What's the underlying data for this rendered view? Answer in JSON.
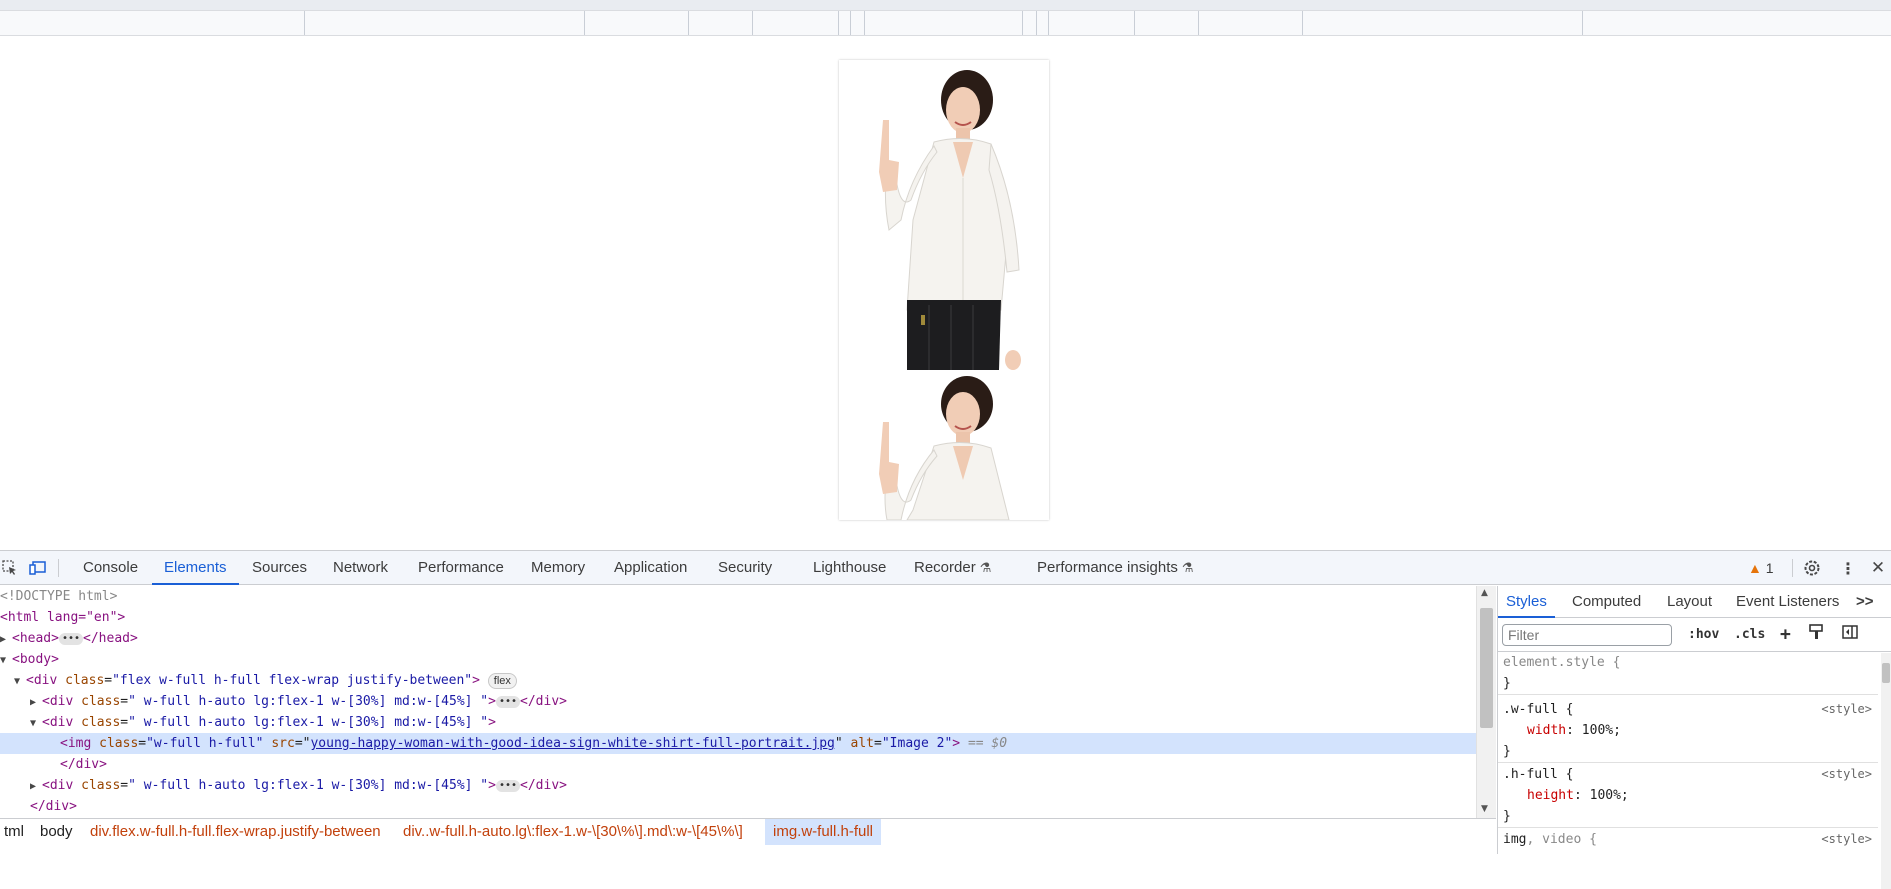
{
  "viewport": {
    "preview": {
      "images": [
        "Image 2",
        "Image 2"
      ]
    }
  },
  "devtools": {
    "tabs": [
      "Console",
      "Elements",
      "Sources",
      "Network",
      "Performance",
      "Memory",
      "Application",
      "Security",
      "Lighthouse",
      "Recorder",
      "Performance insights"
    ],
    "active_tab": "Elements",
    "warnings_count": "1",
    "icons": [
      "inspect-icon",
      "device-toggle-icon",
      "warning-icon",
      "settings-icon",
      "more-icon",
      "close-icon"
    ],
    "elements": {
      "doctype": "<!DOCTYPE html>",
      "html_open": "<html lang=\"en\">",
      "head_open": "<head>",
      "head_close": "</head>",
      "body_open": "<body>",
      "div1_tag": "div",
      "div1_class": "\"flex w-full h-full flex-wrap justify-between\"",
      "div1_badge": "flex",
      "child_class": "\" w-full h-auto lg:flex-1 w-[30%] md:w-[45%] \"",
      "img_class": "\"w-full h-full\"",
      "img_src": "young-happy-woman-with-good-idea-sign-white-shirt-full-portrait.jpg",
      "img_alt": "\"Image 2\"",
      "img_eq": "== $0",
      "div_close": "</div>",
      "attr_class": "class",
      "attr_src": "src",
      "attr_alt": "alt"
    },
    "breadcrumb": [
      "tml",
      "body",
      "div.flex.w-full.h-full.flex-wrap.justify-between",
      "div..w-full.h-auto.lg\\:flex-1.w-\\[30\\%\\].md\\:w-\\[45\\%\\]",
      "img.w-full.h-full"
    ],
    "styles": {
      "tabs": [
        "Styles",
        "Computed",
        "Layout",
        "Event Listeners"
      ],
      "more_tabs": ">>",
      "filter_placeholder": "Filter",
      "hov": ":hov",
      "cls": ".cls",
      "rules": [
        {
          "selector": "element.style {",
          "origin": "",
          "prop": "",
          "val": ""
        },
        {
          "selector": ".w-full {",
          "origin": "<style>",
          "prop": "width",
          "val": "100%;"
        },
        {
          "selector": ".h-full {",
          "origin": "<style>",
          "prop": "height",
          "val": "100%;"
        }
      ],
      "last_selector_a": "img",
      "last_selector_b": ", video {",
      "last_origin": "<style>",
      "close_brace": "}"
    }
  }
}
